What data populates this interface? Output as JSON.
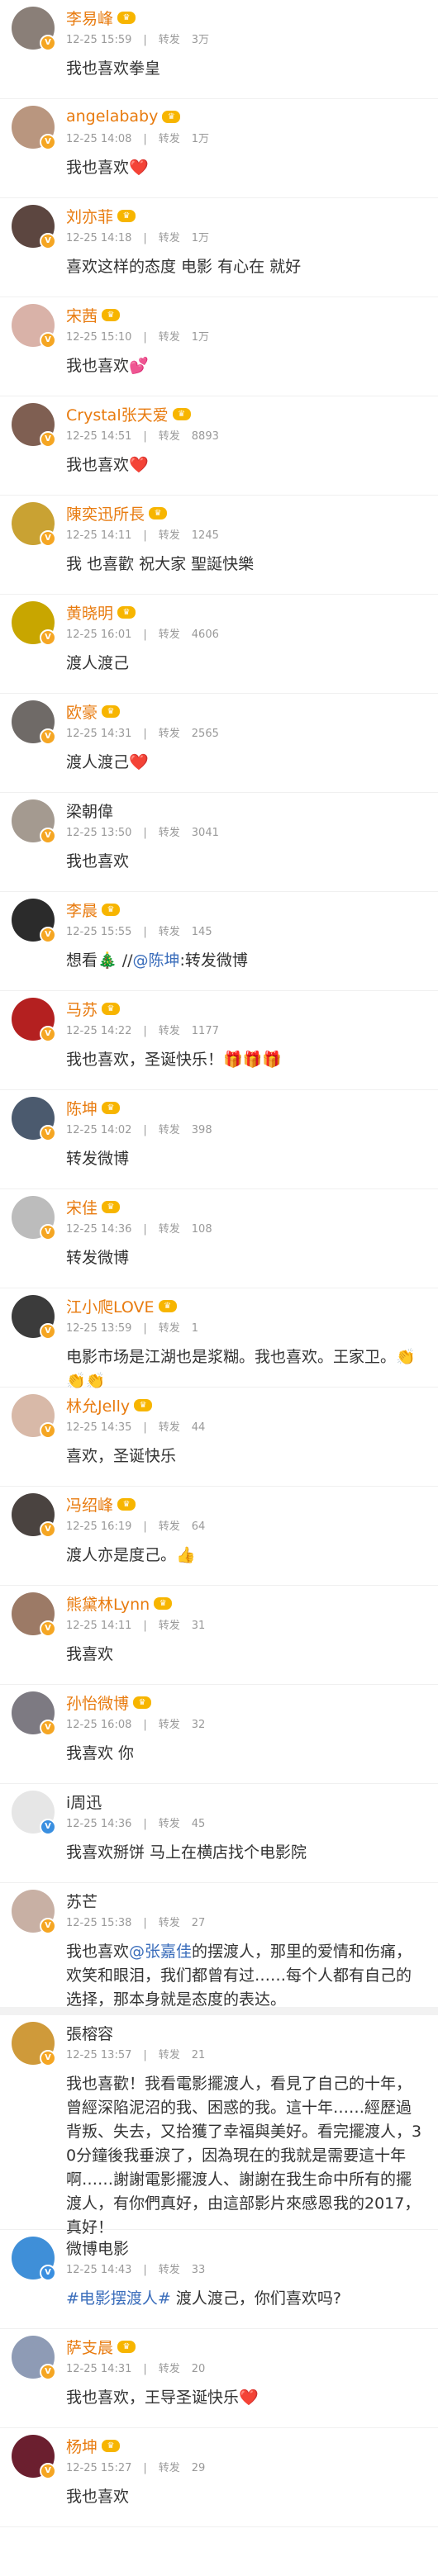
{
  "comments": [
    {
      "name": "李易峰",
      "time": "12-25 15:59",
      "sep": "|",
      "repost_label": "转发",
      "repost_count": "3万",
      "text": "我也喜欢拳皇",
      "avatar_color": "#8a7f78"
    },
    {
      "name": "angelababy",
      "time": "12-25 14:08",
      "sep": "|",
      "repost_label": "转发",
      "repost_count": "1万",
      "text": "我也喜欢❤️",
      "avatar_color": "#b9967f"
    },
    {
      "name": "刘亦菲",
      "time": "12-25 14:18",
      "sep": "|",
      "repost_label": "转发",
      "repost_count": "1万",
      "text": "喜欢这样的态度 电影 有心在 就好",
      "avatar_color": "#5c4640"
    },
    {
      "name": "宋茜",
      "time": "12-25 15:10",
      "sep": "|",
      "repost_label": "转发",
      "repost_count": "1万",
      "text": "我也喜欢💕",
      "avatar_color": "#d9b2a8"
    },
    {
      "name": "Crystal张天爱",
      "time": "12-25 14:51",
      "sep": "|",
      "repost_label": "转发",
      "repost_count": "8893",
      "text": "我也喜欢❤️",
      "avatar_color": "#7f5f52"
    },
    {
      "name": "陳奕迅所長",
      "time": "12-25 14:11",
      "sep": "|",
      "repost_label": "转发",
      "repost_count": "1245",
      "text": "我 也喜歡 祝大家 聖誕快樂",
      "avatar_color": "#c9a233"
    },
    {
      "name": "黄晓明",
      "time": "12-25 16:01",
      "sep": "|",
      "repost_label": "转发",
      "repost_count": "4606",
      "text": "渡人渡己",
      "avatar_color": "#c8a600"
    },
    {
      "name": "欧豪",
      "time": "12-25 14:31",
      "sep": "|",
      "repost_label": "转发",
      "repost_count": "2565",
      "text": "渡人渡己❤️",
      "avatar_color": "#6f6a67"
    },
    {
      "name": "梁朝偉",
      "time": "12-25 13:50",
      "sep": "|",
      "repost_label": "转发",
      "repost_count": "3041",
      "text": "我也喜欢",
      "avatar_color": "#a49a90"
    },
    {
      "name": "李晨",
      "time": "12-25 15:55",
      "sep": "|",
      "repost_label": "转发",
      "repost_count": "145",
      "text_pre": "想看🎄 //",
      "text_link": "@陈坤",
      "text_post": ":转发微博",
      "avatar_color": "#2b2b2b"
    },
    {
      "name": "马苏",
      "time": "12-25 14:22",
      "sep": "|",
      "repost_label": "转发",
      "repost_count": "1177",
      "text": "我也喜欢，圣诞快乐！🎁🎁🎁",
      "avatar_color": "#b42020"
    },
    {
      "name": "陈坤",
      "time": "12-25 14:02",
      "sep": "|",
      "repost_label": "转发",
      "repost_count": "398",
      "text": "转发微博",
      "avatar_color": "#4b5a6e"
    },
    {
      "name": "宋佳",
      "time": "12-25 14:36",
      "sep": "|",
      "repost_label": "转发",
      "repost_count": "108",
      "text": "转发微博",
      "avatar_color": "#bcbcbc"
    },
    {
      "name": "江小爬LOVE",
      "time": "12-25 13:59",
      "sep": "|",
      "repost_label": "转发",
      "repost_count": "1",
      "text": "电影市场是江湖也是浆糊。我也喜欢。王家卫。👏👏👏",
      "avatar_color": "#3b3b3b"
    },
    {
      "name": "林允Jelly",
      "time": "12-25 14:35",
      "sep": "|",
      "repost_label": "转发",
      "repost_count": "44",
      "text": "喜欢，圣诞快乐",
      "avatar_color": "#d8b9a8"
    },
    {
      "name": "冯绍峰",
      "time": "12-25 16:19",
      "sep": "|",
      "repost_label": "转发",
      "repost_count": "64",
      "text": "渡人亦是度己。👍",
      "avatar_color": "#4a4340"
    },
    {
      "name": "熊黛林Lynn",
      "time": "12-25 14:11",
      "sep": "|",
      "repost_label": "转发",
      "repost_count": "31",
      "text": "我喜欢",
      "avatar_color": "#9c7a66"
    },
    {
      "name": "孙怡微博",
      "time": "12-25 16:08",
      "sep": "|",
      "repost_label": "转发",
      "repost_count": "32",
      "text": "我喜欢 你",
      "avatar_color": "#7d7a82"
    },
    {
      "name": "i周迅",
      "time": "12-25 14:36",
      "sep": "|",
      "repost_label": "转发",
      "repost_count": "45",
      "text": "我喜欢掰饼 马上在横店找个电影院",
      "avatar_color": "#e6e6e6"
    },
    {
      "name": "苏芒",
      "time": "12-25 15:38",
      "sep": "|",
      "repost_label": "转发",
      "repost_count": "27",
      "text_pre": "我也喜欢",
      "text_link": "@张嘉佳",
      "text_post": "的摆渡人，那里的爱情和伤痛，欢笑和眼泪，我们都曾有过……每个人都有自己的选择，那本身就是态度的表达。",
      "avatar_color": "#c8b0a4"
    },
    {
      "name": "張榕容",
      "time": "12-25 13:57",
      "sep": "|",
      "repost_label": "转发",
      "repost_count": "21",
      "text": "我也喜歡！我看電影擺渡人，看見了自己的十年，曾經深陷泥沼的我、困惑的我。這十年……經歷過背叛、失去，又拾獲了幸福與美好。看完擺渡人，30分鐘後我垂淚了，因為現在的我就是需要這十年啊……謝謝電影擺渡人、謝謝在我生命中所有的擺渡人，有你們真好，由這部影片來感恩我的2017，真好！",
      "avatar_color": "#cf9a3a"
    },
    {
      "name": "微博电影",
      "time": "12-25 14:43",
      "sep": "|",
      "repost_label": "转发",
      "repost_count": "33",
      "text_link": "#电影摆渡人#",
      "text_post": " 渡人渡己，你们喜欢吗?",
      "avatar_color": "#3f8fd8"
    },
    {
      "name": "萨支晨",
      "time": "12-25 14:31",
      "sep": "|",
      "repost_label": "转发",
      "repost_count": "20",
      "text": "我也喜欢，王导圣诞快乐❤️",
      "avatar_color": "#8e9bb5"
    },
    {
      "name": "杨坤",
      "time": "12-25 15:27",
      "sep": "|",
      "repost_label": "转发",
      "repost_count": "29",
      "text": "我也喜欢",
      "avatar_color": "#6b1f2f"
    }
  ],
  "badges": {
    "verified_mark": "V",
    "vip_mark": "♛"
  },
  "colors": {
    "name": "#e87b0f",
    "link": "#3a6dbb",
    "meta": "#999999"
  }
}
